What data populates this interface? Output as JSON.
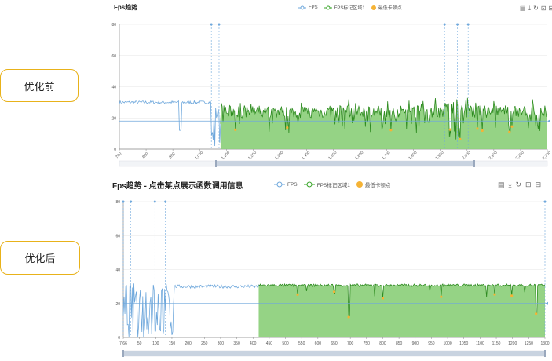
{
  "labels": {
    "before": "优化前",
    "after": "优化后"
  },
  "charts": {
    "top": {
      "title": "Fps趋势",
      "legend": [
        "FPS",
        "FPS标记区域1",
        "最低卡顿点"
      ],
      "toolbox_icons": [
        "data-view-icon",
        "save-image-icon",
        "restore-icon",
        "zoom-icon",
        "zoom-reset-icon"
      ],
      "yticks": [
        "0",
        "20",
        "40",
        "60",
        "80"
      ],
      "xticks": [
        "700",
        "800",
        "900",
        "1,000",
        "1,100",
        "1,200",
        "1,300",
        "1,400",
        "1,500",
        "1,600",
        "1,700",
        "1,800",
        "1,900",
        "2,000",
        "2,100",
        "2,200",
        "2,300"
      ]
    },
    "bottom": {
      "title": "Fps趋势 - 点击某点展示函数调用信息",
      "legend": [
        "FPS",
        "FPS标记区域1",
        "最低卡顿点"
      ],
      "toolbox_icons": [
        "data-view-icon",
        "save-image-icon",
        "restore-icon",
        "zoom-icon",
        "zoom-reset-icon"
      ],
      "yticks": [
        "0",
        "20",
        "40",
        "60",
        "80"
      ],
      "xticks": [
        "7.66",
        "50",
        "100",
        "150",
        "200",
        "250",
        "300",
        "350",
        "400",
        "450",
        "500",
        "550",
        "600",
        "650",
        "700",
        "750",
        "800",
        "850",
        "900",
        "950",
        "1000",
        "1050",
        "1100",
        "1150",
        "1200",
        "1250",
        "1300"
      ]
    }
  },
  "colors": {
    "fps_line": "#6fa8dc",
    "marked_area": "#8fd17e",
    "marked_line": "#2e8b20",
    "low_point": "#f5b335",
    "avg_line": "#6fa8dc",
    "label_border": "#e8b21a"
  },
  "chart_data": [
    {
      "type": "line",
      "title": "Fps趋势",
      "series": [
        {
          "name": "FPS",
          "summary": "≈30 fps from x≈700 to ≈1,120, then large drops to 0 near 1,110"
        },
        {
          "name": "FPS标记区域1",
          "summary": "marked region from ≈1,120 to ≈2,300, fps fluctuating ≈8–32"
        }
      ],
      "ylim": [
        0,
        80
      ],
      "xlim": [
        700,
        2300
      ],
      "average_line": 18
    },
    {
      "type": "line",
      "title": "Fps趋势 - 点击某点展示函数调用信息",
      "series": [
        {
          "name": "FPS",
          "summary": "unstable 0–30 fps from 7.66 to ≈170, then steady ≈30"
        },
        {
          "name": "FPS标记区域1",
          "summary": "marked region from ≈430 to ≈1300, fps ≈30 with occasional dips"
        }
      ],
      "ylim": [
        0,
        80
      ],
      "xlim": [
        7.66,
        1310
      ],
      "average_line": 20
    }
  ]
}
